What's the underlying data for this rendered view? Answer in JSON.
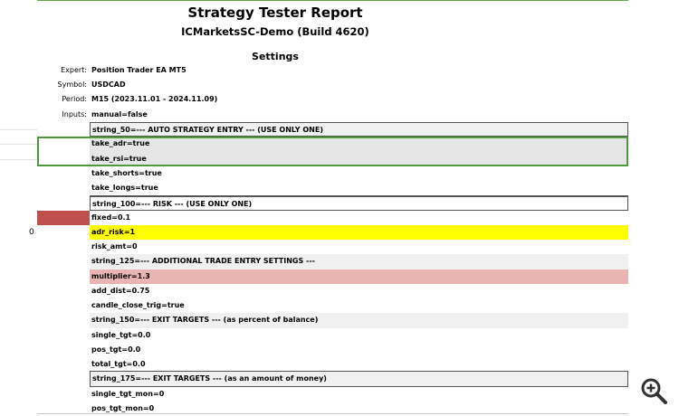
{
  "report": {
    "title": "Strategy Tester Report",
    "subtitle": "ICMarketsSC-Demo (Build 4620)",
    "section": "Settings"
  },
  "info": [
    {
      "key": "Expert:",
      "value": "Position Trader EA MT5"
    },
    {
      "key": "Symbol:",
      "value": "USDCAD"
    },
    {
      "key": "Period:",
      "value": "M15 (2023.11.01 - 2024.11.09)"
    },
    {
      "key": "Inputs:",
      "value": "manual=false"
    }
  ],
  "inputs": [
    "string_50=--- AUTO STRATEGY ENTRY --- (USE ONLY ONE)",
    "take_adr=true",
    "take_rsi=true",
    "take_shorts=true",
    "take_longs=true",
    "string_100=--- RISK --- (USE ONLY ONE)",
    "fixed=0.1",
    "adr_risk=1",
    "risk_amt=0",
    "string_125=--- ADDITIONAL TRADE ENTRY SETTINGS ---",
    "multiplier=1.3",
    "add_dist=0.75",
    "candle_close_trig=true",
    "string_150=--- EXIT TARGETS --- (as percent of balance)",
    "single_tgt=0.0",
    "pos_tgt=0.0",
    "total_tgt=0.0",
    "string_175=--- EXIT TARGETS --- (as an amount of money)",
    "single_tgt_mon=0",
    "pos_tgt_mon=0"
  ],
  "left_marker": "0",
  "colors": {
    "selection_border": "#4e9a3e",
    "highlight_yellow": "#ffff00",
    "highlight_pink": "#e8b4b4",
    "highlight_red": "#c0504d"
  },
  "icons": {
    "zoom": "zoom-in-icon"
  }
}
